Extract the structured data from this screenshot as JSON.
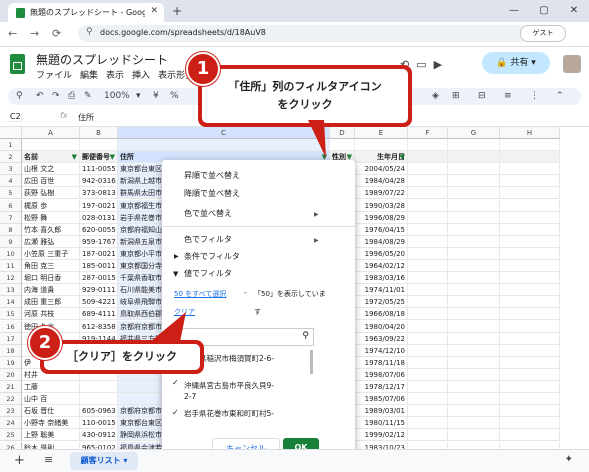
{
  "browser": {
    "tab_title": "無題のスプレッドシート - Google ス",
    "url": "docs.google.com/spreadsheets/d/18AuV8",
    "guest_label": "ゲスト"
  },
  "sheets": {
    "doc_title": "無題のスプレッドシート",
    "menu": [
      "ファイル",
      "編集",
      "表示",
      "挿入",
      "表示形式"
    ],
    "share_label": "共有",
    "zoom": "100%",
    "currency": "¥",
    "percent": "%",
    "cell_ref": "C2",
    "formula_value": "住所"
  },
  "columns": [
    "A",
    "B",
    "C",
    "D",
    "E",
    "F",
    "G",
    "H"
  ],
  "header_row": {
    "num": "2",
    "name": "名前",
    "zip": "郵便番号",
    "addr": "住所",
    "sex": "性別",
    "birth": "生年月日"
  },
  "rows": [
    {
      "n": "3",
      "name": "山根 文之",
      "zip": "111-0055",
      "addr": "東京都台東区",
      "sex": "男",
      "birth": "2004/05/24"
    },
    {
      "n": "4",
      "name": "広田 百世",
      "zip": "942-0316",
      "addr": "新潟県上越市",
      "sex": "女",
      "birth": "1984/04/28"
    },
    {
      "n": "5",
      "name": "荻野 弘樹",
      "zip": "373-0813",
      "addr": "群馬県太田市",
      "sex": "男",
      "birth": "1989/07/22"
    },
    {
      "n": "6",
      "name": "梶原 歩",
      "zip": "197-0021",
      "addr": "東京都福生市",
      "sex": "女",
      "birth": "1990/03/28"
    },
    {
      "n": "7",
      "name": "松野 舞",
      "zip": "028-0131",
      "addr": "岩手県花巻市",
      "sex": "女",
      "birth": "1996/08/29"
    },
    {
      "n": "8",
      "name": "竹本 喜久郎",
      "zip": "620-0055",
      "addr": "京都府福知山",
      "sex": "男",
      "birth": "1976/04/15"
    },
    {
      "n": "9",
      "name": "広瀬 雅弘",
      "zip": "959-1767",
      "addr": "新潟県五泉市",
      "sex": "男",
      "birth": "1984/08/29"
    },
    {
      "n": "10",
      "name": "小笠原 三重子",
      "zip": "187-0021",
      "addr": "東京都小平市",
      "sex": "女",
      "birth": "1996/05/20"
    },
    {
      "n": "11",
      "name": "角田 克三",
      "zip": "185-0011",
      "addr": "東京都国分寺",
      "sex": "男",
      "birth": "1964/02/12"
    },
    {
      "n": "12",
      "name": "堀口 明日香",
      "zip": "287-0015",
      "addr": "千葉県香取市",
      "sex": "女",
      "birth": "1983/03/16"
    },
    {
      "n": "13",
      "name": "内海 道貴",
      "zip": "929-0111",
      "addr": "石川県能美市",
      "sex": "男",
      "birth": "1974/11/01"
    },
    {
      "n": "14",
      "name": "成田 重三郎",
      "zip": "509-4221",
      "addr": "岐阜県飛騨市",
      "sex": "男",
      "birth": "1972/05/25"
    },
    {
      "n": "15",
      "name": "河原 共枝",
      "zip": "689-4111",
      "addr": "鳥取県西伯郡",
      "sex": "女",
      "birth": "1966/08/18"
    },
    {
      "n": "16",
      "name": "徳田 久也",
      "zip": "612-8358",
      "addr": "京都府京都市",
      "sex": "男",
      "birth": "1980/04/20"
    },
    {
      "n": "17",
      "name": "",
      "zip": "919-1144",
      "addr": "福井県三方郡",
      "sex": "女",
      "birth": "1963/09/22"
    },
    {
      "n": "18",
      "name": "",
      "zip": "",
      "addr": "",
      "sex": "女",
      "birth": "1974/12/10"
    },
    {
      "n": "19",
      "name": "伊",
      "zip": "",
      "addr": "",
      "sex": "男",
      "birth": "1978/11/18"
    },
    {
      "n": "20",
      "name": "村井",
      "zip": "",
      "addr": "",
      "sex": "男",
      "birth": "1998/07/06"
    },
    {
      "n": "21",
      "name": "工藤",
      "zip": "",
      "addr": "",
      "sex": "女",
      "birth": "1978/12/17"
    },
    {
      "n": "22",
      "name": "山中 百",
      "zip": "",
      "addr": "",
      "sex": "男",
      "birth": "1985/07/06"
    },
    {
      "n": "23",
      "name": "石坂 晋仕",
      "zip": "605-0963",
      "addr": "京都府京都市",
      "sex": "男",
      "birth": "1989/03/01"
    },
    {
      "n": "24",
      "name": "小野寺 奈緒美",
      "zip": "110-0015",
      "addr": "東京都台東区",
      "sex": "女",
      "birth": "1980/11/15"
    },
    {
      "n": "25",
      "name": "上野 聡美",
      "zip": "430-0912",
      "addr": "静岡県浜松市",
      "sex": "女",
      "birth": "1999/02/12"
    },
    {
      "n": "26",
      "name": "鈴木 是則",
      "zip": "965-0102",
      "addr": "福島県会津若",
      "sex": "男",
      "birth": "1983/10/23"
    }
  ],
  "filter_menu": {
    "sort_asc": "昇順で並べ替え",
    "sort_desc": "降順で並べ替え",
    "sort_color": "色で並べ替え",
    "filter_color": "色でフィルタ",
    "filter_condition": "条件でフィルタ",
    "filter_value": "値でフィルタ",
    "select_all": "50 をすべて選択",
    "showing": "「50」を表示していま",
    "clear": "クリア",
    "clear_tail": "す",
    "values": [
      "愛知県稲沢市梅須賀町2-6-",
      "6",
      "沖縄県宮古島市平良久貝9-",
      "2-7",
      "岩手県花巻市東和町町村5-"
    ],
    "cancel": "キャンセル",
    "ok": "OK"
  },
  "callouts": {
    "one_num": "1",
    "one_line1": "「住所」列のフィルタアイコン",
    "one_line2": "をクリック",
    "two_num": "2",
    "two_text": "［クリア］をクリック"
  },
  "sheet_tab": "顧客リスト",
  "colors": {
    "accent": "#cc1f16",
    "ok": "#188038",
    "sheets_green": "#1e8e3e"
  }
}
